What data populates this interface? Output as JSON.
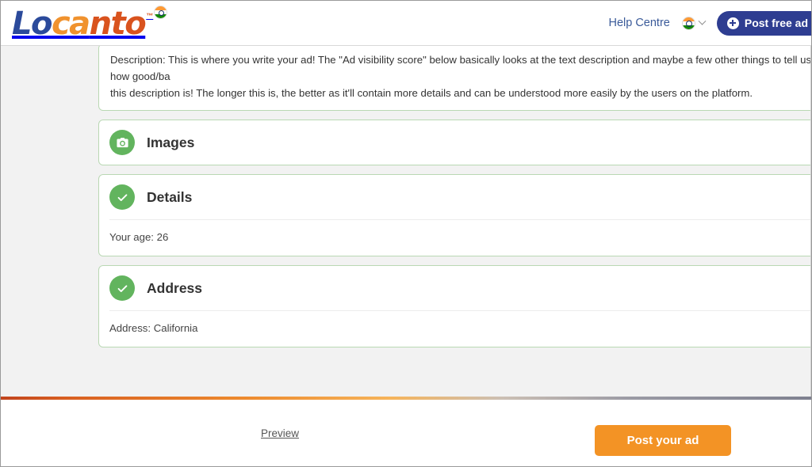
{
  "header": {
    "brand": {
      "part1": "Lo",
      "part2": "ca",
      "part3": "nto",
      "tm": "™",
      "flag_icon": "india-flag-icon"
    },
    "help_link": "Help Centre",
    "language_flag_icon": "india-flag-icon",
    "language_chevron_icon": "chevron-down-icon",
    "post_free_ad": {
      "label": "Post free ad",
      "icon": "plus-circle-icon",
      "bg_color": "#2e3d91"
    }
  },
  "description": {
    "text": "Description: This is where you write your ad! The \"Ad visibility score\" below basically looks at the text description and maybe a few other things to tell us how good/ba\nthis description is! The longer this is, the better as it'll contain more details and can be understood more easily by the users on the platform."
  },
  "sections": [
    {
      "id": "images",
      "title": "Images",
      "icon": "camera-icon",
      "icon_color": "#62b45e",
      "body": null,
      "trailing_icon": "sad-face-icon"
    },
    {
      "id": "details",
      "title": "Details",
      "icon": "check-circle-icon",
      "icon_color": "#62b45e",
      "body": "Your age: 26",
      "trailing_icon": null
    },
    {
      "id": "address",
      "title": "Address",
      "icon": "check-circle-icon",
      "icon_color": "#62b45e",
      "body": "Address: California",
      "trailing_icon": null
    }
  ],
  "footer": {
    "preview_label": "Preview",
    "post_ad_label": "Post your ad",
    "post_ad_color": "#f39325"
  }
}
